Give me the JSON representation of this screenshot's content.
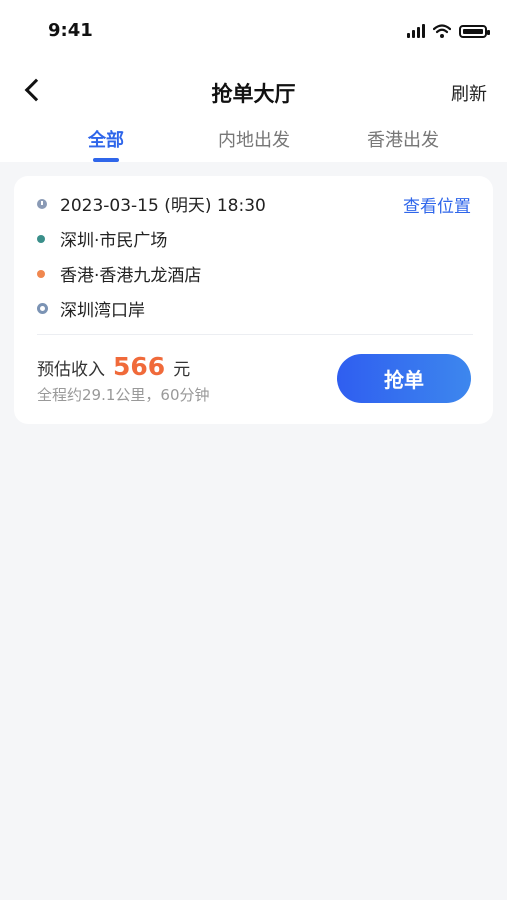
{
  "status_bar": {
    "time": "9:41"
  },
  "nav": {
    "title": "抢单大厅",
    "refresh_label": "刷新"
  },
  "tabs": [
    {
      "label": "全部",
      "active": true
    },
    {
      "label": "内地出发",
      "active": false
    },
    {
      "label": "香港出发",
      "active": false
    }
  ],
  "order": {
    "datetime": "2023-03-15 (明天) 18:30",
    "view_location_label": "查看位置",
    "stops": [
      {
        "text": "深圳·市民广场",
        "color": "#3a8f8a"
      },
      {
        "text": "香港·香港九龙酒店",
        "color": "#f0874f"
      }
    ],
    "destination": "深圳湾口岸",
    "income_label": "预估收入",
    "income_amount": "566",
    "income_unit": "元",
    "summary": "全程约29.1公里，60分钟",
    "grab_label": "抢单"
  },
  "colors": {
    "accent": "#2f66ea",
    "price": "#f06a3a"
  }
}
